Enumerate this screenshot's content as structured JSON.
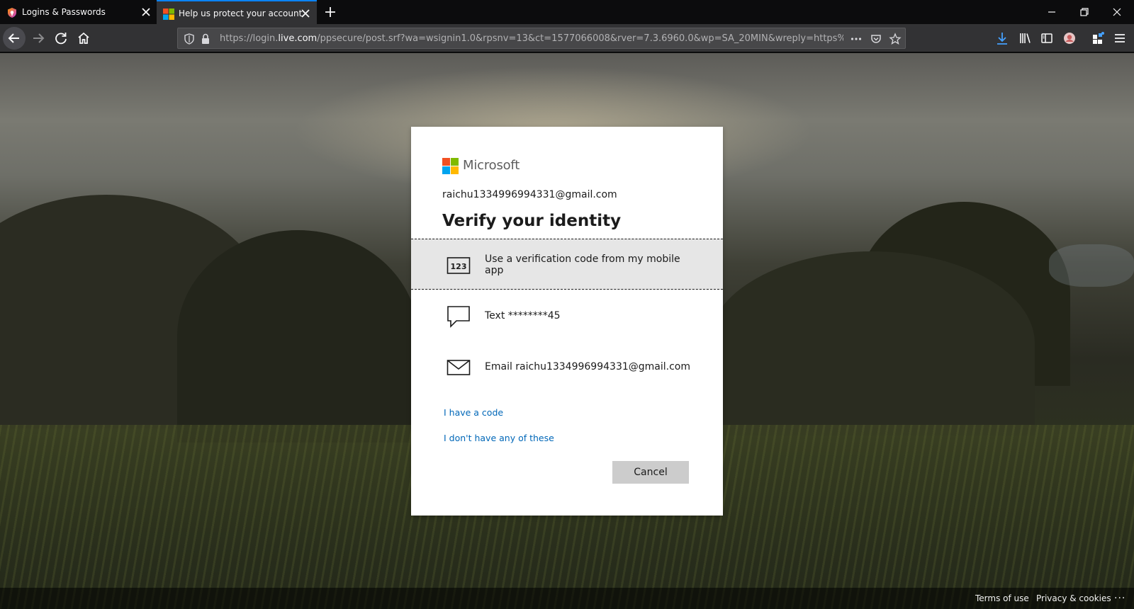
{
  "browser": {
    "tabs": [
      {
        "label": "Logins & Passwords",
        "favicon": "lockwise-icon",
        "active": false
      },
      {
        "label": "Help us protect your account",
        "favicon": "microsoft-icon",
        "active": true
      }
    ],
    "url": {
      "prefix": "https://login.",
      "host": "live.com",
      "path": "/ppsecure/post.srf?wa=wsignin1.0&rpsnv=13&ct=1577066008&rver=7.3.6960.0&wp=SA_20MIN&wreply=https%3A"
    },
    "accent_color": "#0a84ff"
  },
  "dialog": {
    "brand": "Microsoft",
    "account": "raichu1334996994331@gmail.com",
    "title": "Verify your identity",
    "options": [
      {
        "icon": "authenticator-code-icon",
        "icon_text": "123",
        "label": "Use a verification code from my mobile app",
        "selected": true
      },
      {
        "icon": "sms-message-icon",
        "label": "Text ********45",
        "selected": false
      },
      {
        "icon": "email-envelope-icon",
        "label": "Email raichu1334996994331@gmail.com",
        "selected": false
      }
    ],
    "links": {
      "have_code": "I have a code",
      "none": "I don't have any of these"
    },
    "cancel_label": "Cancel",
    "link_color": "#0067b8"
  },
  "footer": {
    "terms": "Terms of use",
    "privacy": "Privacy & cookies",
    "more": "..."
  }
}
